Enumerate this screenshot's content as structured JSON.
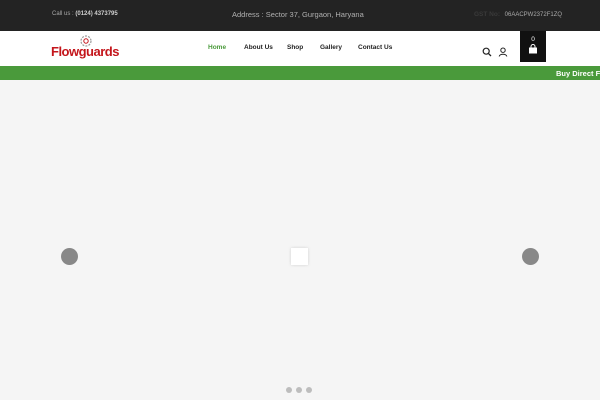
{
  "topbar": {
    "call_label": "Call us :",
    "call_number": "(0124) 4373795",
    "address": "Address : Sector 37, Gurgaon, Haryana",
    "gst_label": "GST No:",
    "gst_number": "06AACPW2372F1ZQ"
  },
  "brand": {
    "logo_text": "Flowguards",
    "logo_color": "#c4161c",
    "accent_color": "#4a9a3b"
  },
  "nav": {
    "items": [
      {
        "label": "Home",
        "active": true
      },
      {
        "label": "About Us",
        "active": false
      },
      {
        "label": "Shop",
        "active": false
      },
      {
        "label": "Gallery",
        "active": false
      },
      {
        "label": "Contact Us",
        "active": false
      }
    ]
  },
  "header_icons": {
    "search": "search-icon",
    "account": "user-icon",
    "cart": "shopping-bag-icon",
    "cart_count": "0"
  },
  "promo": {
    "text": "Buy Direct Fro"
  },
  "slider": {
    "prev": "previous-slide-arrow",
    "next": "next-slide-arrow",
    "dots": 3
  }
}
